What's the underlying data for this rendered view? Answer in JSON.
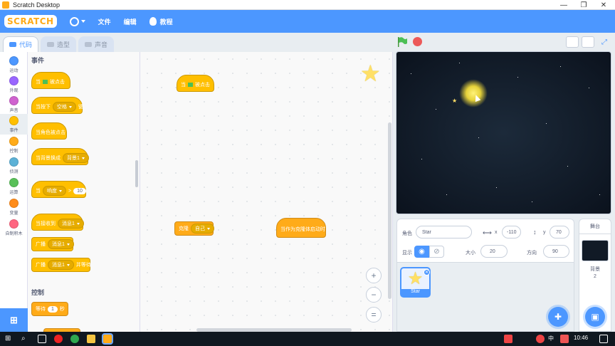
{
  "window": {
    "title": "Scratch Desktop"
  },
  "menubar": {
    "logo": "SCRATCH",
    "file": "文件",
    "edit": "编辑",
    "tutorials": "教程"
  },
  "tabs": {
    "code": "代码",
    "costumes": "造型",
    "sounds": "声音"
  },
  "categories": [
    {
      "label": "运动",
      "color": "#4c97ff"
    },
    {
      "label": "外观",
      "color": "#9966ff"
    },
    {
      "label": "声音",
      "color": "#cf63cf"
    },
    {
      "label": "事件",
      "color": "#ffbf00"
    },
    {
      "label": "控制",
      "color": "#ffab19"
    },
    {
      "label": "侦测",
      "color": "#5cb1d6"
    },
    {
      "label": "运算",
      "color": "#59c059"
    },
    {
      "label": "变量",
      "color": "#ff8c1a"
    },
    {
      "label": "自制积木",
      "color": "#ff6680"
    }
  ],
  "palette": {
    "section_events": "事件",
    "section_control": "控制",
    "when_flag_prefix": "当",
    "when_flag_suffix": "被点击",
    "when_key_prefix": "当按下",
    "when_key_dropdown": "空格",
    "when_key_suffix": "键",
    "when_sprite_clicked": "当角色被点击",
    "when_backdrop_prefix": "当背景换成",
    "when_backdrop_dropdown": "背景1",
    "when_loudness_prefix": "当",
    "when_loudness_dropdown": "响度",
    "when_loudness_op": ">",
    "when_loudness_value": "10",
    "when_receive_prefix": "当接收到",
    "when_receive_dropdown": "消息1",
    "broadcast_prefix": "广播",
    "broadcast_dropdown": "消息1",
    "broadcast_wait_prefix": "广播",
    "broadcast_wait_dropdown": "消息1",
    "broadcast_wait_suffix": "并等待",
    "wait_prefix": "等待",
    "wait_value": "1",
    "wait_suffix": "秒"
  },
  "workspace": {
    "flag_block_prefix": "当",
    "flag_block_suffix": "被点击",
    "clone_prefix": "克隆",
    "clone_dropdown": "自己",
    "clone_start": "当作为克隆体启动时",
    "zoom_in": "+",
    "zoom_out": "−",
    "zoom_reset": "="
  },
  "sprite_info": {
    "sprite_label": "角色",
    "sprite_name": "Star",
    "x_label": "x",
    "x_value": "-110",
    "y_label": "y",
    "y_value": "70",
    "show_label": "显示",
    "size_label": "大小",
    "size_value": "20",
    "direction_label": "方向",
    "direction_value": "90"
  },
  "sprites": [
    {
      "name": "Star"
    }
  ],
  "stage_panel": {
    "header": "舞台",
    "backdrops_label": "背景",
    "backdrops_count": "2"
  },
  "taskbar": {
    "ime": "中",
    "time": "10:46"
  },
  "colors": {
    "accent": "#4c97ff",
    "events": "#ffbf00",
    "control": "#ffab19"
  }
}
